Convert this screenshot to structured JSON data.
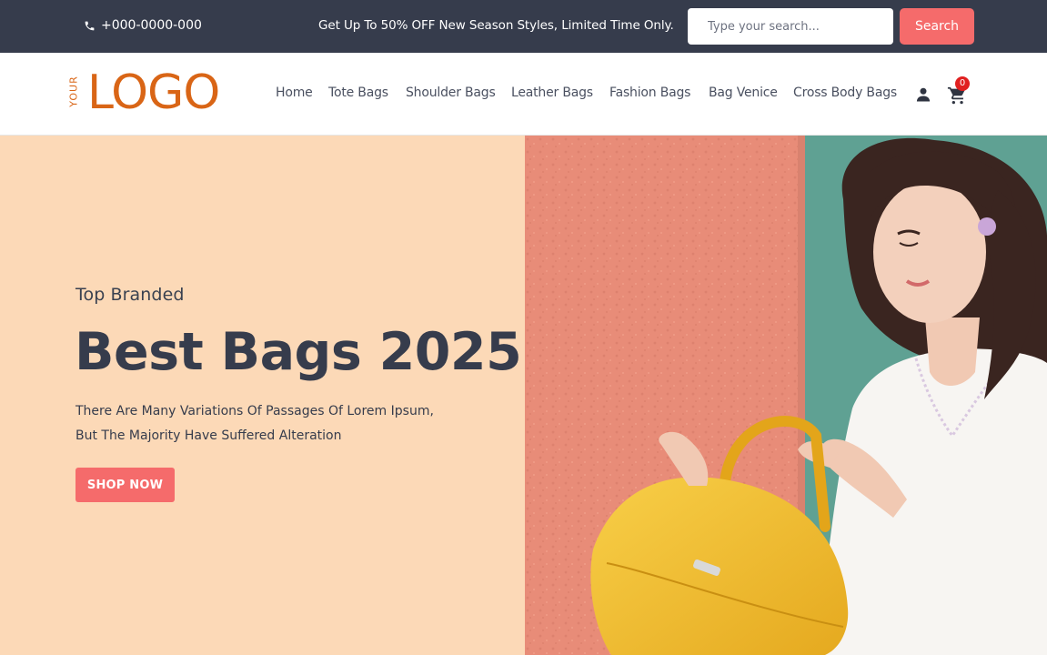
{
  "topbar": {
    "phone": "+000-0000-000",
    "promo": "Get Up To 50% OFF New Season Styles, Limited Time Only.",
    "search_placeholder": "Type your search...",
    "search_button": "Search",
    "icons": {
      "phone": "phone-icon"
    }
  },
  "header": {
    "logo_your": "YOUR",
    "logo_main": "LOGO",
    "nav": [
      "Home",
      "Tote Bags",
      "Shoulder Bags",
      "Leather Bags",
      "Fashion Bags",
      "Bag Venice",
      "Cross Body Bags"
    ],
    "cart_count": "0",
    "icons": {
      "user": "user-icon",
      "cart": "cart-icon"
    }
  },
  "hero": {
    "kicker": "Top Branded",
    "title": "Best Bags 2025",
    "desc_line1": "There Are Many Variations Of Passages Of Lorem Ipsum,",
    "desc_line2": "But The Majority Have Suffered Alteration",
    "cta": "SHOP NOW"
  },
  "colors": {
    "topbar_bg": "#363c4c",
    "accent": "#f56b6b",
    "logo": "#d96516",
    "hero_bg": "#fcd9b7",
    "wall": "#e88c78",
    "teal": "#5fa193",
    "bag": "#f3c132"
  }
}
